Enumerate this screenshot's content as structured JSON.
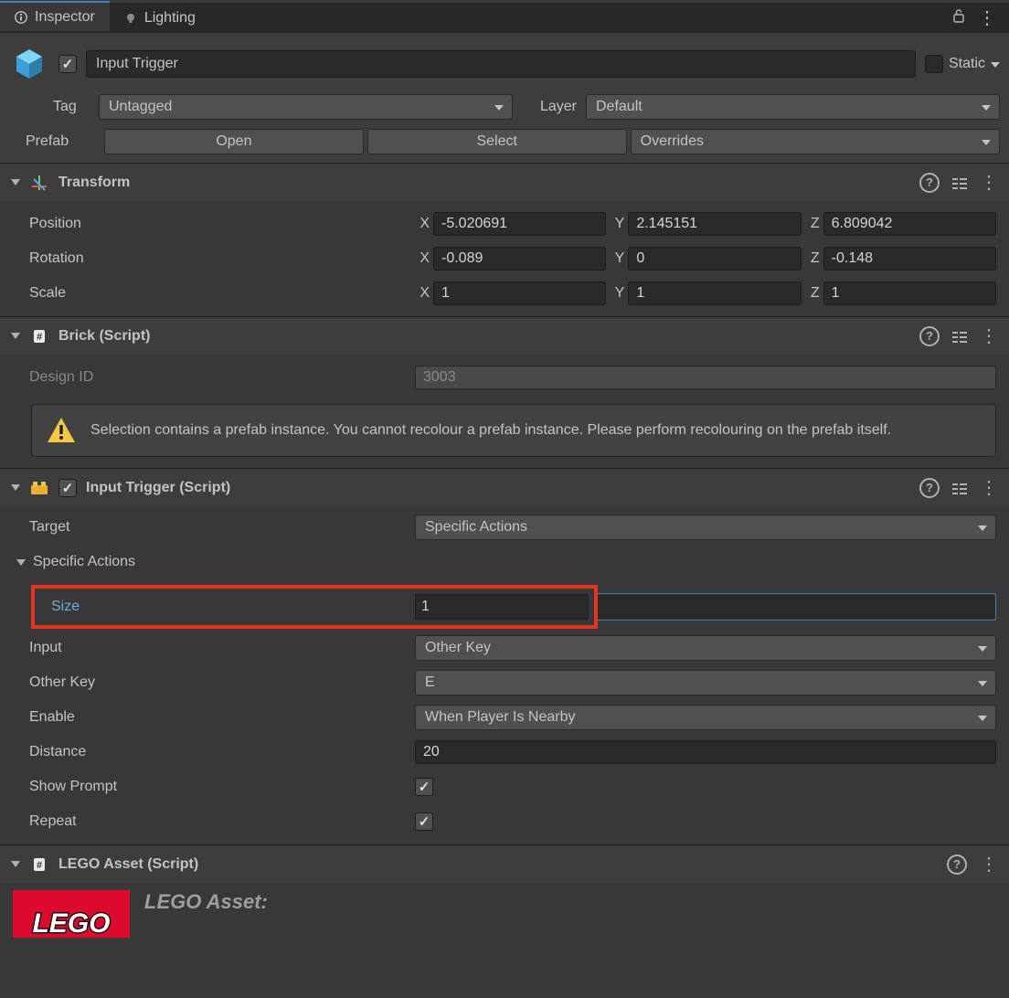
{
  "tabs": {
    "inspector": "Inspector",
    "lighting": "Lighting"
  },
  "header": {
    "object_name": "Input Trigger",
    "static_label": "Static",
    "tag_label": "Tag",
    "tag_value": "Untagged",
    "layer_label": "Layer",
    "layer_value": "Default",
    "prefab_label": "Prefab",
    "open_btn": "Open",
    "select_btn": "Select",
    "overrides_btn": "Overrides"
  },
  "transform": {
    "title": "Transform",
    "position_label": "Position",
    "rotation_label": "Rotation",
    "scale_label": "Scale",
    "pos": {
      "x": "-5.020691",
      "y": "2.145151",
      "z": "6.809042"
    },
    "rot": {
      "x": "-0.089",
      "y": "0",
      "z": "-0.148"
    },
    "scl": {
      "x": "1",
      "y": "1",
      "z": "1"
    }
  },
  "brick": {
    "title": "Brick (Script)",
    "design_id_label": "Design ID",
    "design_id_value": "3003",
    "warning": "Selection contains a prefab instance. You cannot recolour a prefab instance. Please perform recolouring on the prefab itself."
  },
  "input_trigger": {
    "title": "Input Trigger (Script)",
    "target_label": "Target",
    "target_value": "Specific Actions",
    "specific_actions_label": "Specific Actions",
    "size_label": "Size",
    "size_value": "1",
    "input_label": "Input",
    "input_value": "Other Key",
    "other_key_label": "Other Key",
    "other_key_value": "E",
    "enable_label": "Enable",
    "enable_value": "When Player Is Nearby",
    "distance_label": "Distance",
    "distance_value": "20",
    "show_prompt_label": "Show Prompt",
    "repeat_label": "Repeat"
  },
  "lego_asset": {
    "title": "LEGO Asset (Script)",
    "body_title": "LEGO Asset:"
  }
}
